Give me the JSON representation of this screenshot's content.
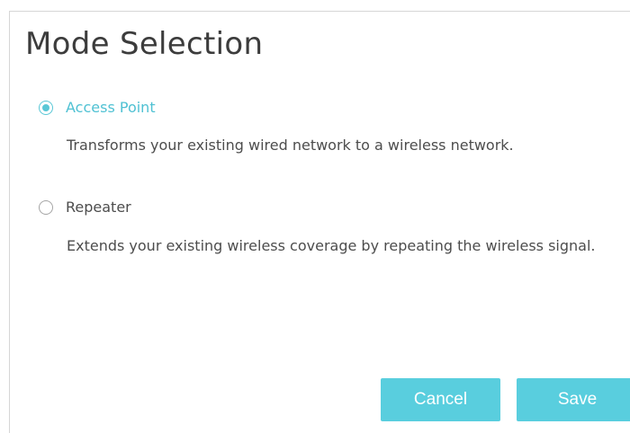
{
  "title": "Mode Selection",
  "options": [
    {
      "label": "Access Point",
      "description": "Transforms your existing wired network to a wireless network.",
      "selected": true
    },
    {
      "label": "Repeater",
      "description": "Extends your existing wireless coverage by repeating the wireless signal.",
      "selected": false
    }
  ],
  "buttons": {
    "cancel_label": "Cancel",
    "save_label": "Save"
  },
  "colors": {
    "accent": "#59cede",
    "selected_text": "#4fc1d3",
    "body_text": "#4d4d4d"
  }
}
